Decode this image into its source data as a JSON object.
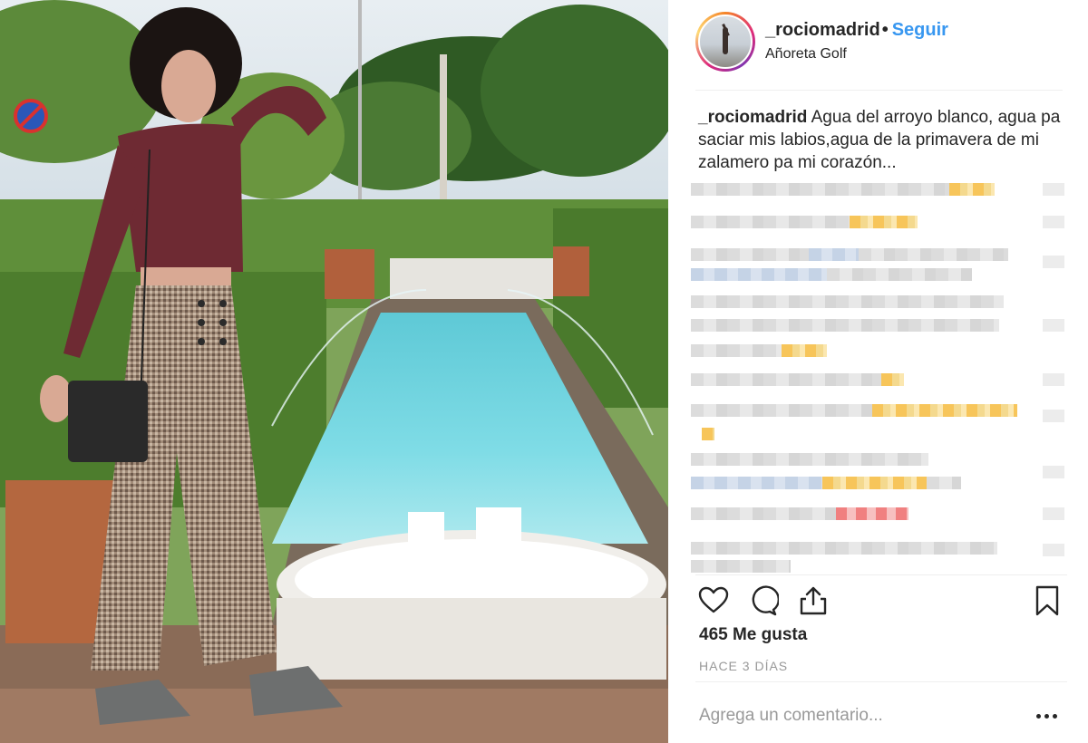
{
  "post": {
    "username": "_rociomadrid",
    "follow_label": "Seguir",
    "separator": "•",
    "location": "Añoreta Golf",
    "caption": "Agua del arroyo blanco, agua pa saciar mis labios,agua de la primavera de mi zalamero pa mi corazón...",
    "likes": "465 Me gusta",
    "date": "HACE 3 DÍAS",
    "comment_placeholder": "Agrega un comentario..."
  },
  "icons": {
    "like": "heart-icon",
    "comment": "comment-bubble-icon",
    "share": "share-icon",
    "save": "bookmark-icon",
    "more": "more-options-icon"
  },
  "colors": {
    "follow": "#3897f0",
    "text": "#262626",
    "muted": "#999999",
    "divider": "#efefef"
  }
}
